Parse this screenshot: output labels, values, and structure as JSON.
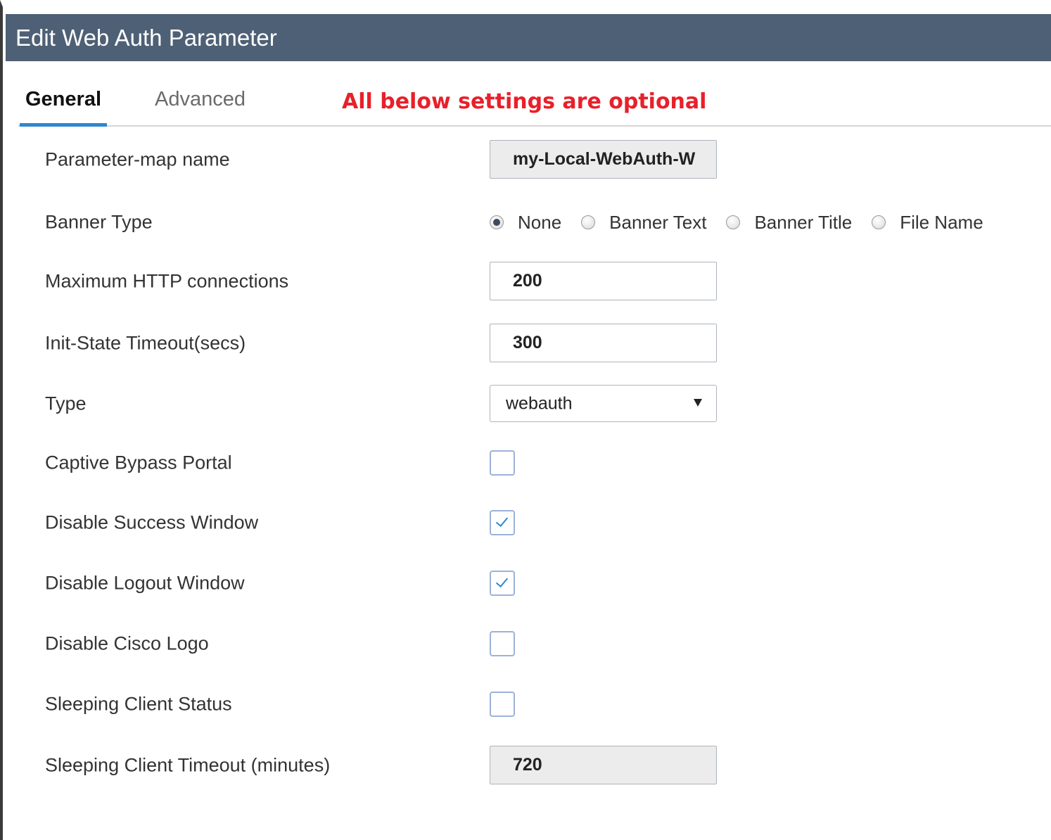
{
  "dialog": {
    "title": "Edit Web Auth Parameter"
  },
  "tabs": [
    {
      "label": "General",
      "active": true
    },
    {
      "label": "Advanced",
      "active": false
    }
  ],
  "note": {
    "text": "All below settings are optional",
    "color": "#e8202a"
  },
  "fields": {
    "parameter_map_name": {
      "label": "Parameter-map name",
      "value": "my-Local-WebAuth-W"
    },
    "banner_type": {
      "label": "Banner Type",
      "options": [
        "None",
        "Banner Text",
        "Banner Title",
        "File Name"
      ],
      "selected": "None"
    },
    "max_http_connections": {
      "label": "Maximum HTTP connections",
      "value": "200"
    },
    "init_state_timeout": {
      "label": "Init-State Timeout(secs)",
      "value": "300"
    },
    "type": {
      "label": "Type",
      "value": "webauth"
    },
    "captive_bypass_portal": {
      "label": "Captive Bypass Portal",
      "checked": false
    },
    "disable_success_window": {
      "label": "Disable Success Window",
      "checked": true
    },
    "disable_logout_window": {
      "label": "Disable Logout Window",
      "checked": true
    },
    "disable_cisco_logo": {
      "label": "Disable Cisco Logo",
      "checked": false
    },
    "sleeping_client_status": {
      "label": "Sleeping Client Status",
      "checked": false
    },
    "sleeping_client_timeout": {
      "label": "Sleeping Client Timeout (minutes)",
      "value": "720"
    }
  },
  "colors": {
    "titlebar": "#4e6075",
    "accent": "#2f86cf"
  }
}
